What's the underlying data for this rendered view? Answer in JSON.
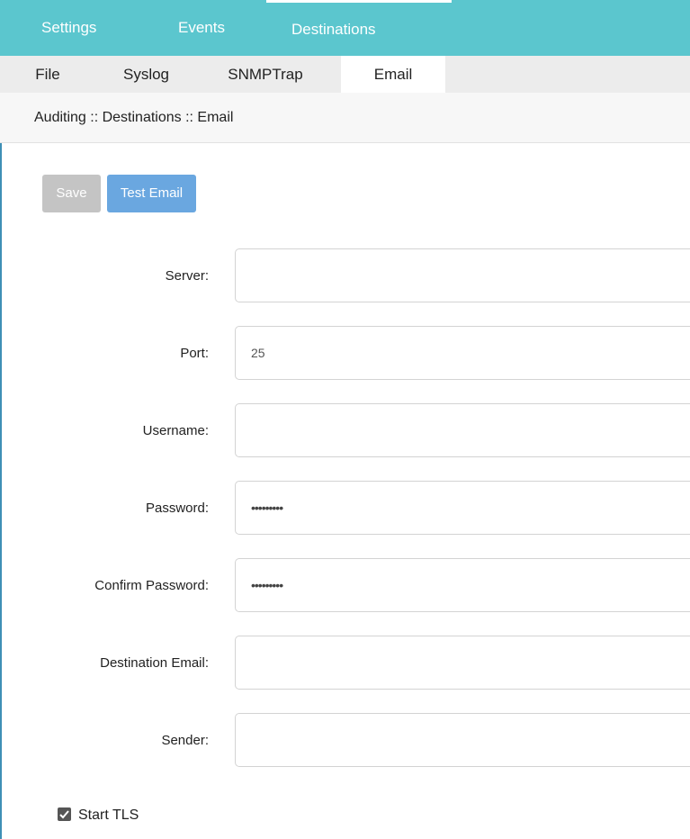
{
  "top_tabs": [
    {
      "label": "Settings"
    },
    {
      "label": "Events"
    },
    {
      "label": "Destinations"
    }
  ],
  "sub_tabs": [
    {
      "label": "File"
    },
    {
      "label": "Syslog"
    },
    {
      "label": "SNMPTrap"
    },
    {
      "label": "Email"
    }
  ],
  "breadcrumb": "Auditing :: Destinations :: Email",
  "toolbar": {
    "save_label": "Save",
    "test_label": "Test Email"
  },
  "form": {
    "server": {
      "label": "Server:",
      "value": ""
    },
    "port": {
      "label": "Port:",
      "value": "25"
    },
    "username": {
      "label": "Username:",
      "value": ""
    },
    "password": {
      "label": "Password:",
      "value": "•••••••••"
    },
    "confirm_password": {
      "label": "Confirm Password:",
      "value": "•••••••••"
    },
    "destination_email": {
      "label": "Destination Email:",
      "value": ""
    },
    "sender": {
      "label": "Sender:",
      "value": ""
    },
    "start_tls": {
      "label": "Start TLS",
      "checked": true
    }
  },
  "colors": {
    "header": "#5bc6ce",
    "test_button": "#6aa7e0",
    "save_button_disabled": "#c4c4c4"
  }
}
